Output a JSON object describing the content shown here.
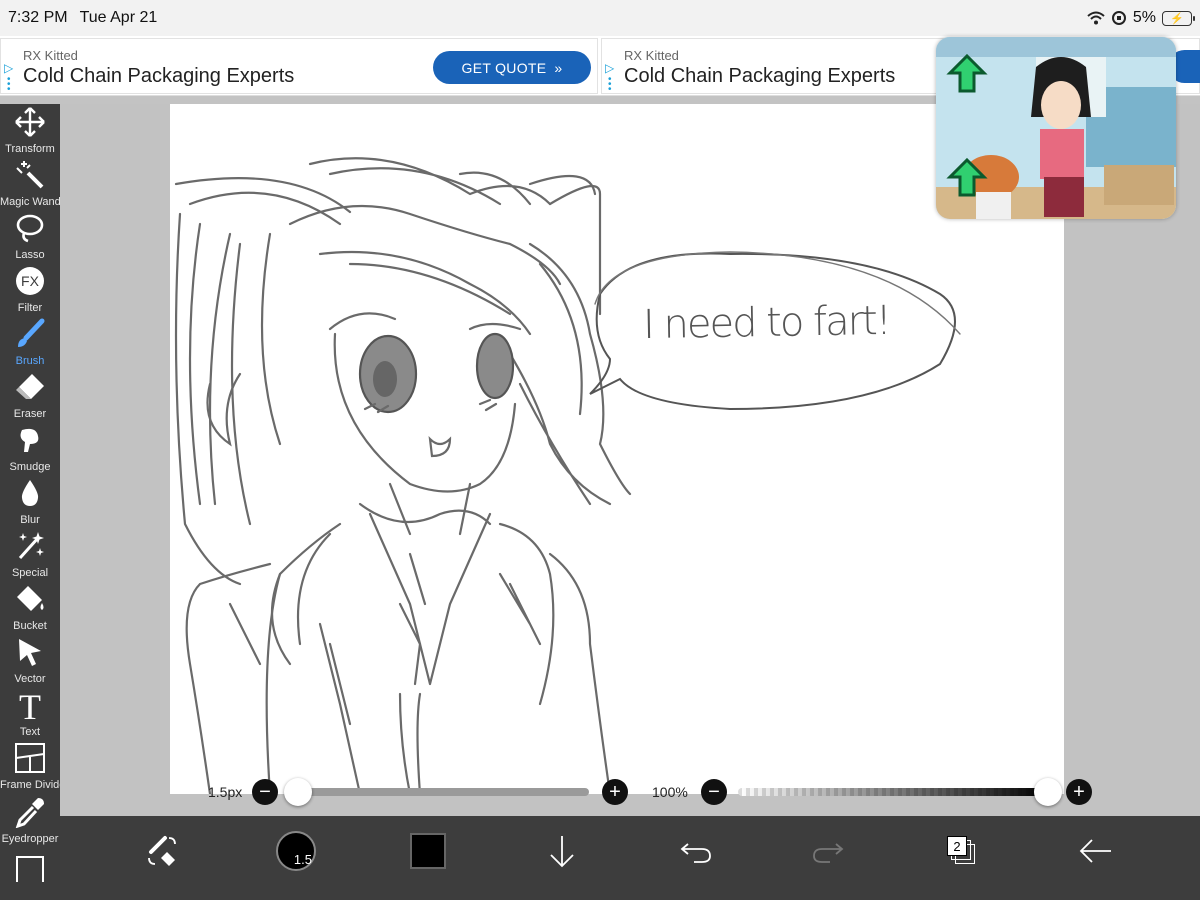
{
  "status_bar": {
    "time": "7:32 PM",
    "date": "Tue Apr 21",
    "battery_pct": "5%"
  },
  "ads": [
    {
      "brand": "RX Kitted",
      "title": "Cold Chain Packaging Experts",
      "cta": "GET QUOTE"
    },
    {
      "brand": "RX Kitted",
      "title": "Cold Chain Packaging Experts"
    }
  ],
  "tools": [
    {
      "label": "Transform",
      "icon": "transform-icon"
    },
    {
      "label": "Magic Wand",
      "icon": "magic-wand-icon"
    },
    {
      "label": "Lasso",
      "icon": "lasso-icon"
    },
    {
      "label": "Filter",
      "icon": "fx-icon",
      "glyph": "FX"
    },
    {
      "label": "Brush",
      "icon": "brush-icon",
      "active": true
    },
    {
      "label": "Eraser",
      "icon": "eraser-icon"
    },
    {
      "label": "Smudge",
      "icon": "smudge-icon"
    },
    {
      "label": "Blur",
      "icon": "blur-icon"
    },
    {
      "label": "Special",
      "icon": "special-icon"
    },
    {
      "label": "Bucket",
      "icon": "bucket-icon"
    },
    {
      "label": "Vector",
      "icon": "vector-icon"
    },
    {
      "label": "Text",
      "icon": "text-icon",
      "glyph": "T"
    },
    {
      "label": "Frame Divider",
      "icon": "frame-divider-icon"
    },
    {
      "label": "Eyedropper",
      "icon": "eyedropper-icon"
    }
  ],
  "canvas": {
    "speech_bubble_text": "I need to fart!"
  },
  "brush_size": {
    "label": "1.5px",
    "value_fraction": 0.0
  },
  "opacity": {
    "label": "100%",
    "value_fraction": 1.0
  },
  "bottom_bar": {
    "brush_size_badge": "1.5",
    "layer_count": "2",
    "color": "#000000"
  },
  "colors": {
    "accent": "#59a7ff",
    "ad_cta": "#1a63b8",
    "toolbar": "#3c3c3c"
  }
}
